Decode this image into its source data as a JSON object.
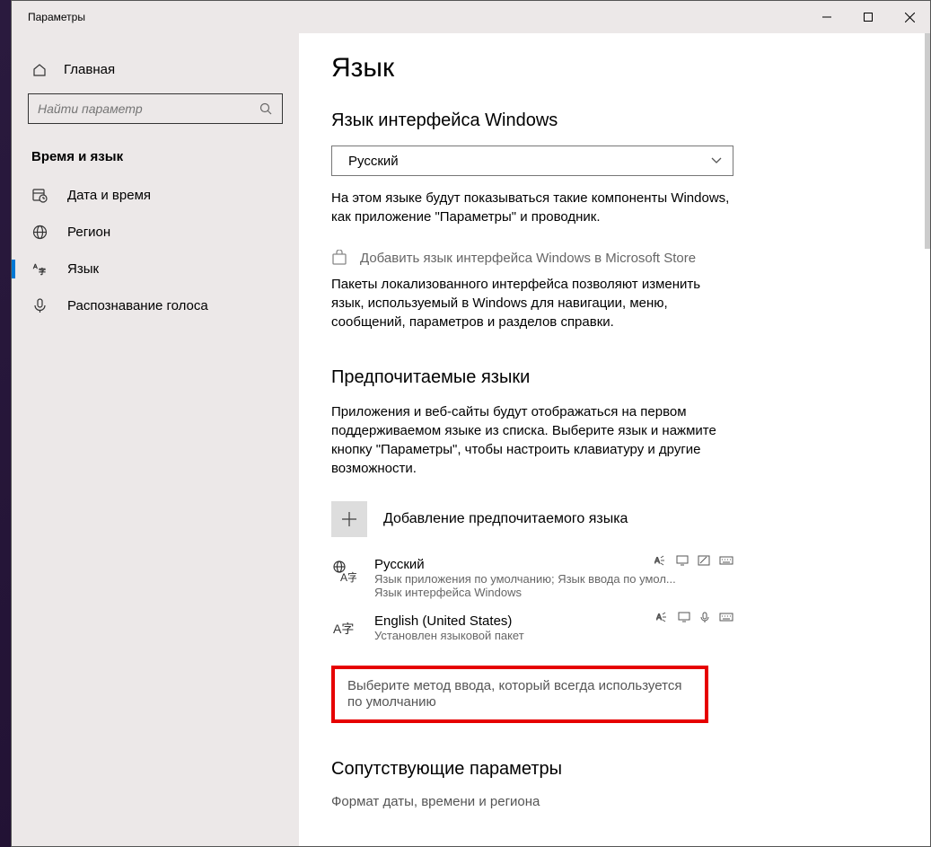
{
  "titlebar": {
    "title": "Параметры"
  },
  "sidebar": {
    "home": "Главная",
    "search_placeholder": "Найти параметр",
    "section": "Время и язык",
    "items": [
      {
        "label": "Дата и время"
      },
      {
        "label": "Регион"
      },
      {
        "label": "Язык"
      },
      {
        "label": "Распознавание голоса"
      }
    ]
  },
  "main": {
    "title": "Язык",
    "display_lang": {
      "heading": "Язык интерфейса Windows",
      "selected": "Русский",
      "desc": "На этом языке будут показываться такие компоненты Windows, как приложение \"Параметры\" и проводник.",
      "store_link": "Добавить язык интерфейса Windows в Microsoft Store",
      "store_desc": "Пакеты локализованного интерфейса позволяют изменить язык, используемый в Windows для навигации, меню, сообщений, параметров и разделов справки."
    },
    "preferred": {
      "heading": "Предпочитаемые языки",
      "desc": "Приложения и веб-сайты будут отображаться на первом поддерживаемом языке из списка. Выберите язык и нажмите кнопку \"Параметры\", чтобы настроить клавиатуру и другие возможности.",
      "add_label": "Добавление предпочитаемого языка",
      "items": [
        {
          "name": "Русский",
          "sub1": "Язык приложения по умолчанию; Язык ввода по умол...",
          "sub2": "Язык интерфейса Windows"
        },
        {
          "name": "English (United States)",
          "sub1": "Установлен языковой пакет",
          "sub2": ""
        }
      ]
    },
    "input_link": "Выберите метод ввода, который всегда используется по умолчанию",
    "related": {
      "heading": "Сопутствующие параметры",
      "link1": "Формат даты, времени и региона"
    }
  }
}
